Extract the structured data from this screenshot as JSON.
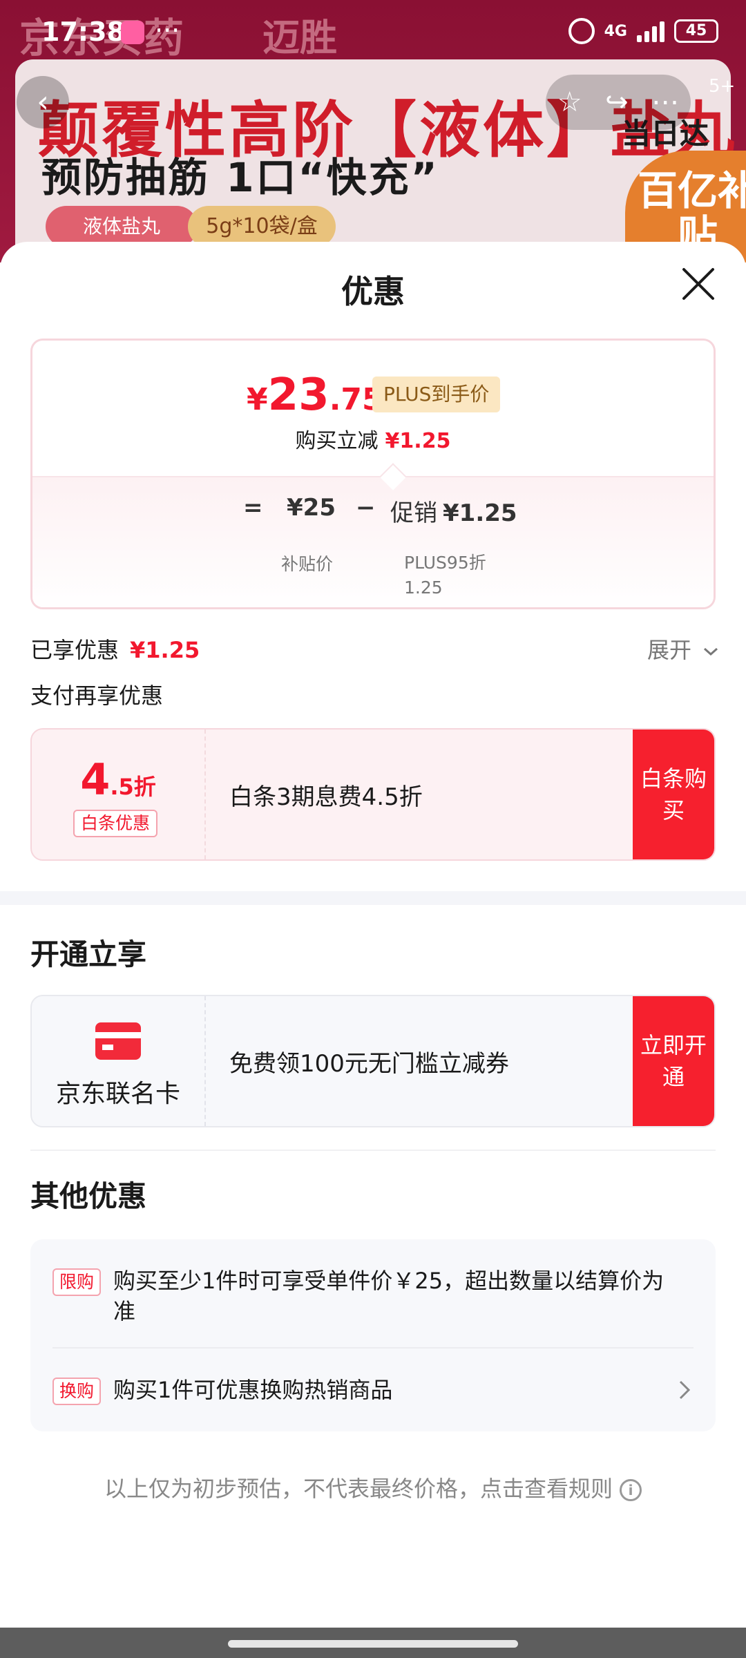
{
  "status_bar": {
    "time": "17:38",
    "dots": "···",
    "network": "4G",
    "battery": "45"
  },
  "banner": {
    "store_logo": "京东买药",
    "brand": "迈胜",
    "headline": "颠覆性高阶【液体】盐丸",
    "subline": "预防抽筋 1口“快充”",
    "pill_a": "液体盐丸",
    "pill_b": "5g*10袋/盒",
    "delivery": "当日达",
    "badge": "百亿补贴",
    "more_badge": "5+"
  },
  "sheet": {
    "title": "优惠",
    "price_card": {
      "currency": "¥",
      "price_int": "23",
      "price_dec": ".75",
      "plus_tag": "PLUS到手价",
      "instant_reduce_label": "购买立减",
      "instant_reduce_value": "¥1.25",
      "eq": "=",
      "subsidy_value": "¥25",
      "minus": "−",
      "promo_label": "促销",
      "promo_value": "¥1.25",
      "subsidy_caption": "补贴价",
      "promo_caption": "PLUS95折 1.25"
    },
    "enjoyed_label": "已享优惠",
    "enjoyed_value": "¥1.25",
    "expand_label": "展开",
    "pay_more_label": "支付再享优惠",
    "baitiao": {
      "rate_big": "4",
      "rate_small": ".5折",
      "tag": "白条优惠",
      "desc": "白条3期息费4.5折",
      "button": "白条购买"
    },
    "open_section_title": "开通立享",
    "jd_card": {
      "name": "京东联名卡",
      "desc": "免费领100元无门槛立减券",
      "button": "立即开通"
    },
    "other_section_title": "其他优惠",
    "other_offers": [
      {
        "tag": "限购",
        "text": "购买至少1件时可享受单件价￥25，超出数量以结算价为准"
      },
      {
        "tag": "换购",
        "text": "购买1件可优惠换购热销商品"
      }
    ],
    "disclaimer": "以上仅为初步预估，不代表最终价格，点击查看规则",
    "info_icon_char": "i"
  }
}
